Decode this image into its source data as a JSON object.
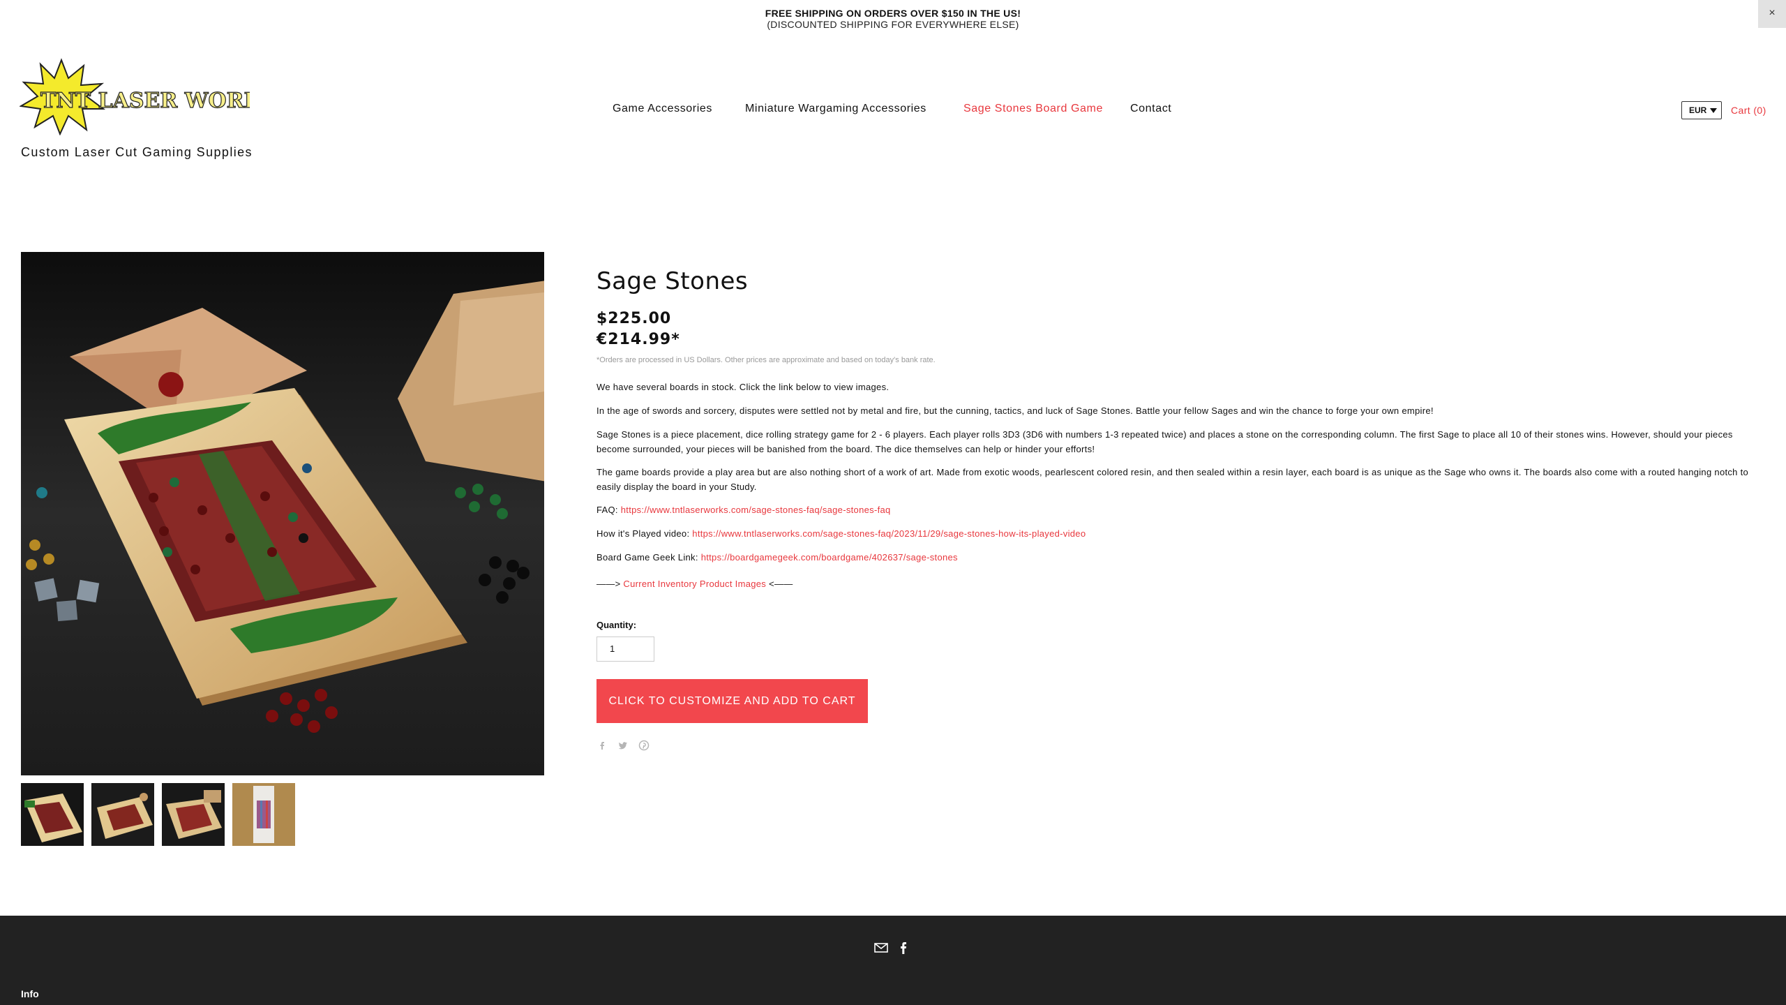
{
  "announcement": {
    "line1": "FREE SHIPPING ON ORDERS OVER $150 IN THE US!",
    "line2": "(DISCOUNTED SHIPPING FOR EVERYWHERE ELSE)",
    "close_label": "×"
  },
  "brand": {
    "logo_text": "TNT LASER WORKS LLC",
    "tagline": "Custom Laser Cut Gaming Supplies"
  },
  "nav": {
    "items": [
      {
        "label": "Game Accessories"
      },
      {
        "label": "Miniature Wargaming Accessories"
      },
      {
        "label": "Sage Stones Board Game"
      },
      {
        "label": "Contact"
      }
    ],
    "active_color": "#e8373d"
  },
  "header": {
    "currency": "EUR",
    "cart_label": "Cart (0)"
  },
  "product": {
    "title": "Sage Stones",
    "price_usd": "$225.00",
    "price_eur": "€214.99*",
    "price_note": "*Orders are processed in US Dollars. Other prices are approximate and based on today's bank rate.",
    "desc_p1": "We have several boards in stock. Click the link below to view images.",
    "desc_p2": "In the age of swords and sorcery, disputes were settled not by metal and fire, but the cunning, tactics, and luck of Sage Stones. Battle your fellow Sages and win the chance to forge your own empire!",
    "desc_p3": "Sage Stones is a piece placement, dice rolling strategy game for 2 - 6 players. Each player rolls 3D3 (3D6 with numbers 1-3 repeated twice) and places a stone on the corresponding column. The first Sage to place all 10 of their stones wins. However, should your pieces become surrounded, your pieces will be banished from the board. The dice themselves can help or hinder your efforts!",
    "desc_p4": "The game boards provide a play area but are also nothing short of a work of art. Made from exotic woods, pearlescent colored resin, and then sealed within a resin layer, each board is as unique as the Sage who owns it. The boards also come with a routed hanging notch to easily display the board in your Study.",
    "faq_label": "FAQ:",
    "faq_link": "https://www.tntlaserworks.com/sage-stones-faq/sage-stones-faq",
    "video_label": "How it's Played video:",
    "video_link": "https://www.tntlaserworks.com/sage-stones-faq/2023/11/29/sage-stones-how-its-played-video",
    "bgg_label": "Board Game Geek Link:",
    "bgg_link": "https://boardgamegeek.com/boardgame/402637/sage-stones",
    "inventory_prefix": "——>",
    "inventory_link": "Current Inventory Product Images",
    "inventory_suffix": "<——",
    "quantity_label": "Quantity:",
    "quantity_value": "1",
    "cta_label": "CLICK TO CUSTOMIZE AND ADD TO CART"
  },
  "share_icons": [
    "facebook-icon",
    "twitter-icon",
    "pinterest-icon"
  ],
  "thumbnails": [
    "product-thumbnail-1",
    "product-thumbnail-2",
    "product-thumbnail-3",
    "product-thumbnail-4"
  ],
  "footer": {
    "icons": [
      "email-icon",
      "facebook-icon"
    ],
    "info_label": "Info"
  },
  "colors": {
    "accent": "#e8373d",
    "cta": "#f2474d",
    "footer_bg": "#222222"
  }
}
